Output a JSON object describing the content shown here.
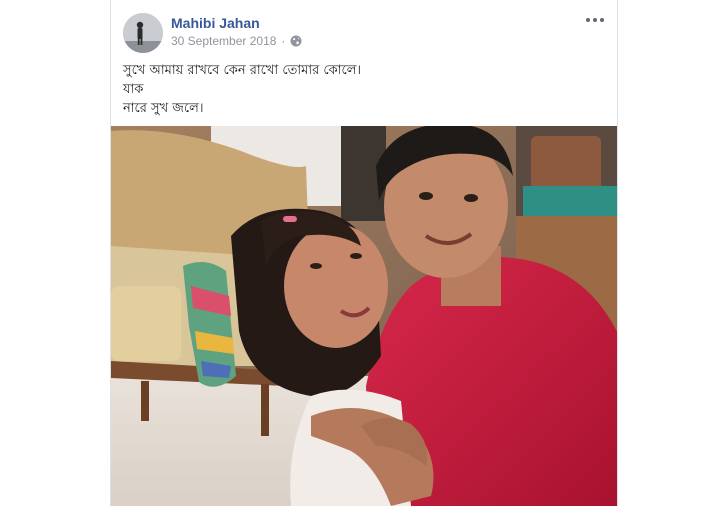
{
  "post": {
    "author_name": "Mahibi Jahan",
    "timestamp": "30 September 2018",
    "audience_icon": "globe-icon",
    "more_icon": "more-options-icon",
    "text_lines": [
      "সুখে আমায় রাখবে কেন রাখো তোমার কোলে।",
      "যাক",
      "নারে সুখ জলে।"
    ],
    "photo": {
      "subject": "selfie-photo"
    }
  },
  "colors": {
    "author_link": "#385898",
    "meta_text": "#90949c",
    "body_text": "#1c1e21",
    "border": "#dddfe2"
  }
}
